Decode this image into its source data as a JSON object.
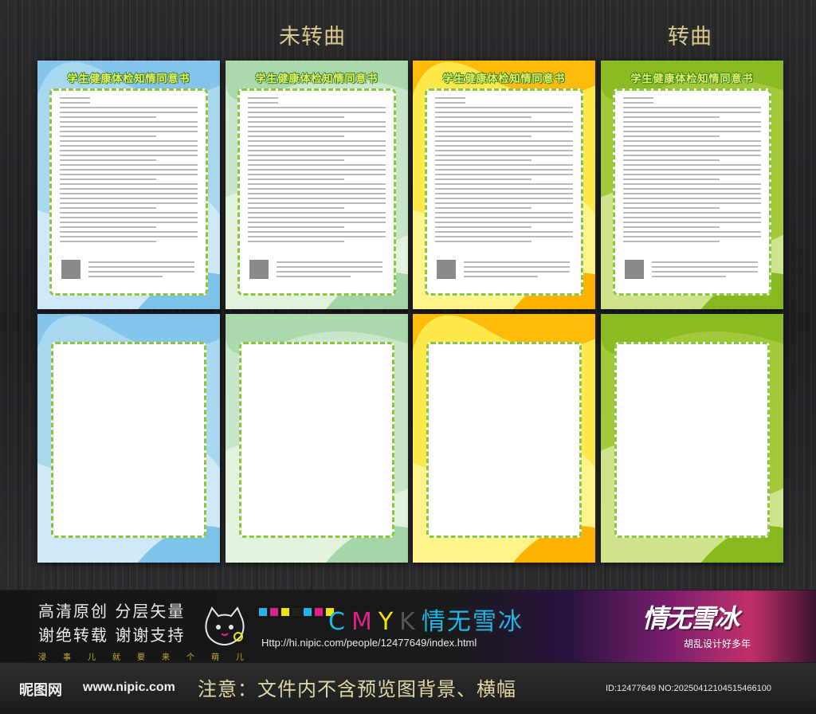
{
  "headings": {
    "outlined_label": "未转曲",
    "converted_label": "转曲"
  },
  "document": {
    "title": "学生健康体检知情同意书"
  },
  "cards": [
    {
      "theme": "blue",
      "bg": "#a8d8f0",
      "wave1": "#cfe9f8",
      "wave2": "#7fc2ea"
    },
    {
      "theme": "mint",
      "bg": "#c8e6c9",
      "wave1": "#e3f2dc",
      "wave2": "#a5d6a7"
    },
    {
      "theme": "yellow",
      "bg": "#ffe94a",
      "wave1": "#fff48a",
      "wave2": "#ffb300"
    },
    {
      "theme": "lime",
      "bg": "#a3c83a",
      "wave1": "#cfe38a",
      "wave2": "#86b81f"
    }
  ],
  "banner": {
    "slogan_line1": "高清原创 分层矢量",
    "slogan_line2": "谢绝转载 谢谢支持",
    "small_chars": [
      "浸",
      "事",
      "儿",
      "就",
      "要",
      "来",
      "个",
      "萌",
      "儿"
    ],
    "cmyk_letters": [
      {
        "char": "C",
        "color": "#1fb8e6"
      },
      {
        "char": "M",
        "color": "#e0218a"
      },
      {
        "char": "Y",
        "color": "#f2e600"
      },
      {
        "char": "K",
        "color": "#555555"
      }
    ],
    "cmyk_suffix": "情无雪冰",
    "cmyk_box_colors": [
      "#1fb8e6",
      "#e0218a",
      "#f2e600",
      "#222222",
      "#1fb8e6",
      "#e0218a",
      "#f2e600"
    ],
    "url": "Http://hi.nipic.com/people/12477649/index.html",
    "brand_script": "情无雪冰",
    "brand_sub": "胡乱设计好多年"
  },
  "footer": {
    "logo_cn": "昵图网",
    "logo_url": "www.nipic.com",
    "notice": "注意：文件内不含预览图背景、横幅",
    "id_text": "ID:12477649 NO:20250412104515466100"
  }
}
